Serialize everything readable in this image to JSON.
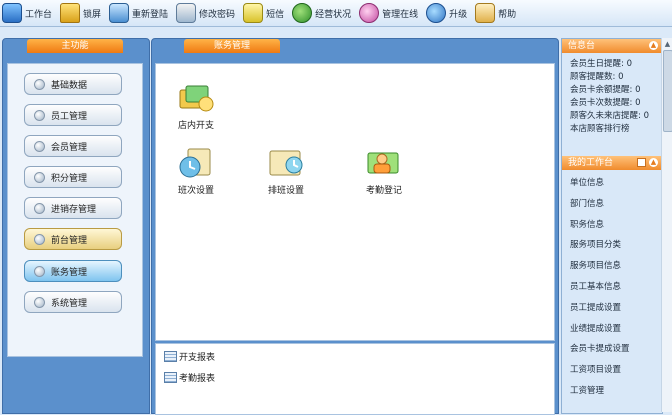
{
  "toolbar": {
    "items": [
      {
        "label": "工作台",
        "icon": "workbench-icon"
      },
      {
        "label": "锁屏",
        "icon": "lock-icon"
      },
      {
        "label": "重新登陆",
        "icon": "relogin-icon"
      },
      {
        "label": "修改密码",
        "icon": "password-icon"
      },
      {
        "label": "短信",
        "icon": "sms-icon"
      },
      {
        "label": "经营状况",
        "icon": "business-status-icon"
      },
      {
        "label": "管理在线",
        "icon": "manage-online-icon"
      },
      {
        "label": "升级",
        "icon": "upgrade-icon"
      },
      {
        "label": "帮助",
        "icon": "help-icon"
      }
    ]
  },
  "left": {
    "title": "主功能",
    "menu": [
      {
        "label": "基础数据"
      },
      {
        "label": "员工管理"
      },
      {
        "label": "会员管理"
      },
      {
        "label": "积分管理"
      },
      {
        "label": "进销存管理"
      },
      {
        "label": "前台管理"
      },
      {
        "label": "账务管理"
      },
      {
        "label": "系统管理"
      }
    ]
  },
  "center": {
    "title": "账务管理",
    "features": [
      {
        "label": "店内开支",
        "icon": "store-expense-icon"
      },
      {
        "label": "班次设置",
        "icon": "shift-settings-icon"
      },
      {
        "label": "排班设置",
        "icon": "schedule-settings-icon"
      },
      {
        "label": "考勤登记",
        "icon": "attendance-icon"
      }
    ],
    "reports": [
      {
        "label": "开支报表"
      },
      {
        "label": "考勤报表"
      }
    ]
  },
  "right": {
    "info_title": "信息台",
    "info_lines": [
      {
        "label": "会员生日提醒: 0"
      },
      {
        "label": "顾客提醒数: 0"
      },
      {
        "label": "会员卡余额提醒: 0"
      },
      {
        "label": "会员卡次数提醒: 0"
      },
      {
        "label": "顾客久未来店提醒: 0"
      },
      {
        "label": "本店顾客排行榜"
      }
    ],
    "work_title": "我的工作台",
    "work_items": [
      {
        "label": "单位信息"
      },
      {
        "label": "部门信息"
      },
      {
        "label": "职务信息"
      },
      {
        "label": "服务项目分类"
      },
      {
        "label": "服务项目信息"
      },
      {
        "label": "员工基本信息"
      },
      {
        "label": "员工提成设置"
      },
      {
        "label": "业绩提成设置"
      },
      {
        "label": "会员卡提成设置"
      },
      {
        "label": "工资项目设置"
      },
      {
        "label": "工资管理"
      }
    ]
  }
}
